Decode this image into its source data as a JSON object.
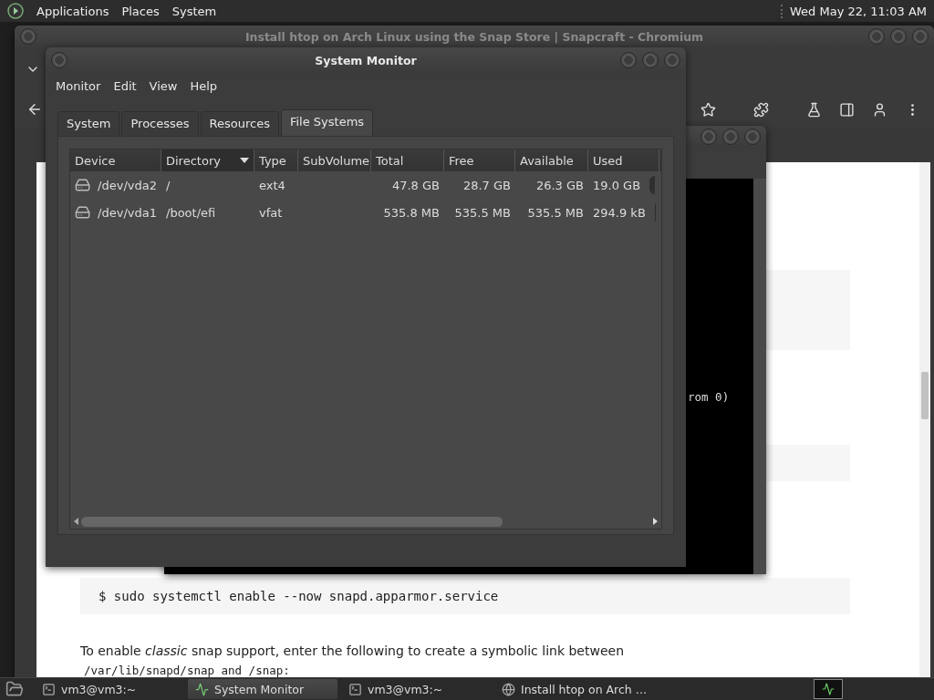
{
  "top_panel": {
    "menus": [
      "Applications",
      "Places",
      "System"
    ],
    "clock": "Wed May 22, 11:03 AM"
  },
  "browser": {
    "title": "Install htop on Arch Linux using the Snap Store | Snapcraft - Chromium",
    "command": "$ sudo systemctl enable --now snapd.apparmor.service",
    "paragraph": "To enable *classic* snap support, enter the following to create a symbolic link between",
    "path_line": "/var/lib/snapd/snap and /snap:"
  },
  "terminal": {
    "visible_text": "rom 0)"
  },
  "system_monitor": {
    "title": "System Monitor",
    "menu": [
      "Monitor",
      "Edit",
      "View",
      "Help"
    ],
    "tabs": [
      {
        "label": "System",
        "selected": false
      },
      {
        "label": "Processes",
        "selected": false
      },
      {
        "label": "Resources",
        "selected": false
      },
      {
        "label": "File Systems",
        "selected": true
      }
    ],
    "columns": [
      {
        "label": "Device",
        "sorted": false
      },
      {
        "label": "Directory",
        "sorted": true
      },
      {
        "label": "Type",
        "sorted": false
      },
      {
        "label": "SubVolume",
        "sorted": false
      },
      {
        "label": "Total",
        "sorted": false
      },
      {
        "label": "Free",
        "sorted": false
      },
      {
        "label": "Available",
        "sorted": false
      },
      {
        "label": "Used",
        "sorted": false
      }
    ],
    "rows": [
      {
        "device": "/dev/vda2",
        "directory": "/",
        "type": "ext4",
        "total": "47.8 GB",
        "free": "28.7 GB",
        "available": "26.3 GB",
        "used": "19.0 GB"
      },
      {
        "device": "/dev/vda1",
        "directory": "/boot/efi",
        "type": "vfat",
        "total": "535.8 MB",
        "free": "535.5 MB",
        "available": "535.5 MB",
        "used": "294.9 kB"
      }
    ]
  },
  "taskbar": [
    {
      "kind": "terminal",
      "label": "vm3@vm3:~",
      "selected": false
    },
    {
      "kind": "monitor",
      "label": "System Monitor",
      "selected": true
    },
    {
      "kind": "terminal",
      "label": "vm3@vm3:~",
      "selected": false
    },
    {
      "kind": "browser",
      "label": "Install htop on Arch …",
      "selected": false
    }
  ]
}
